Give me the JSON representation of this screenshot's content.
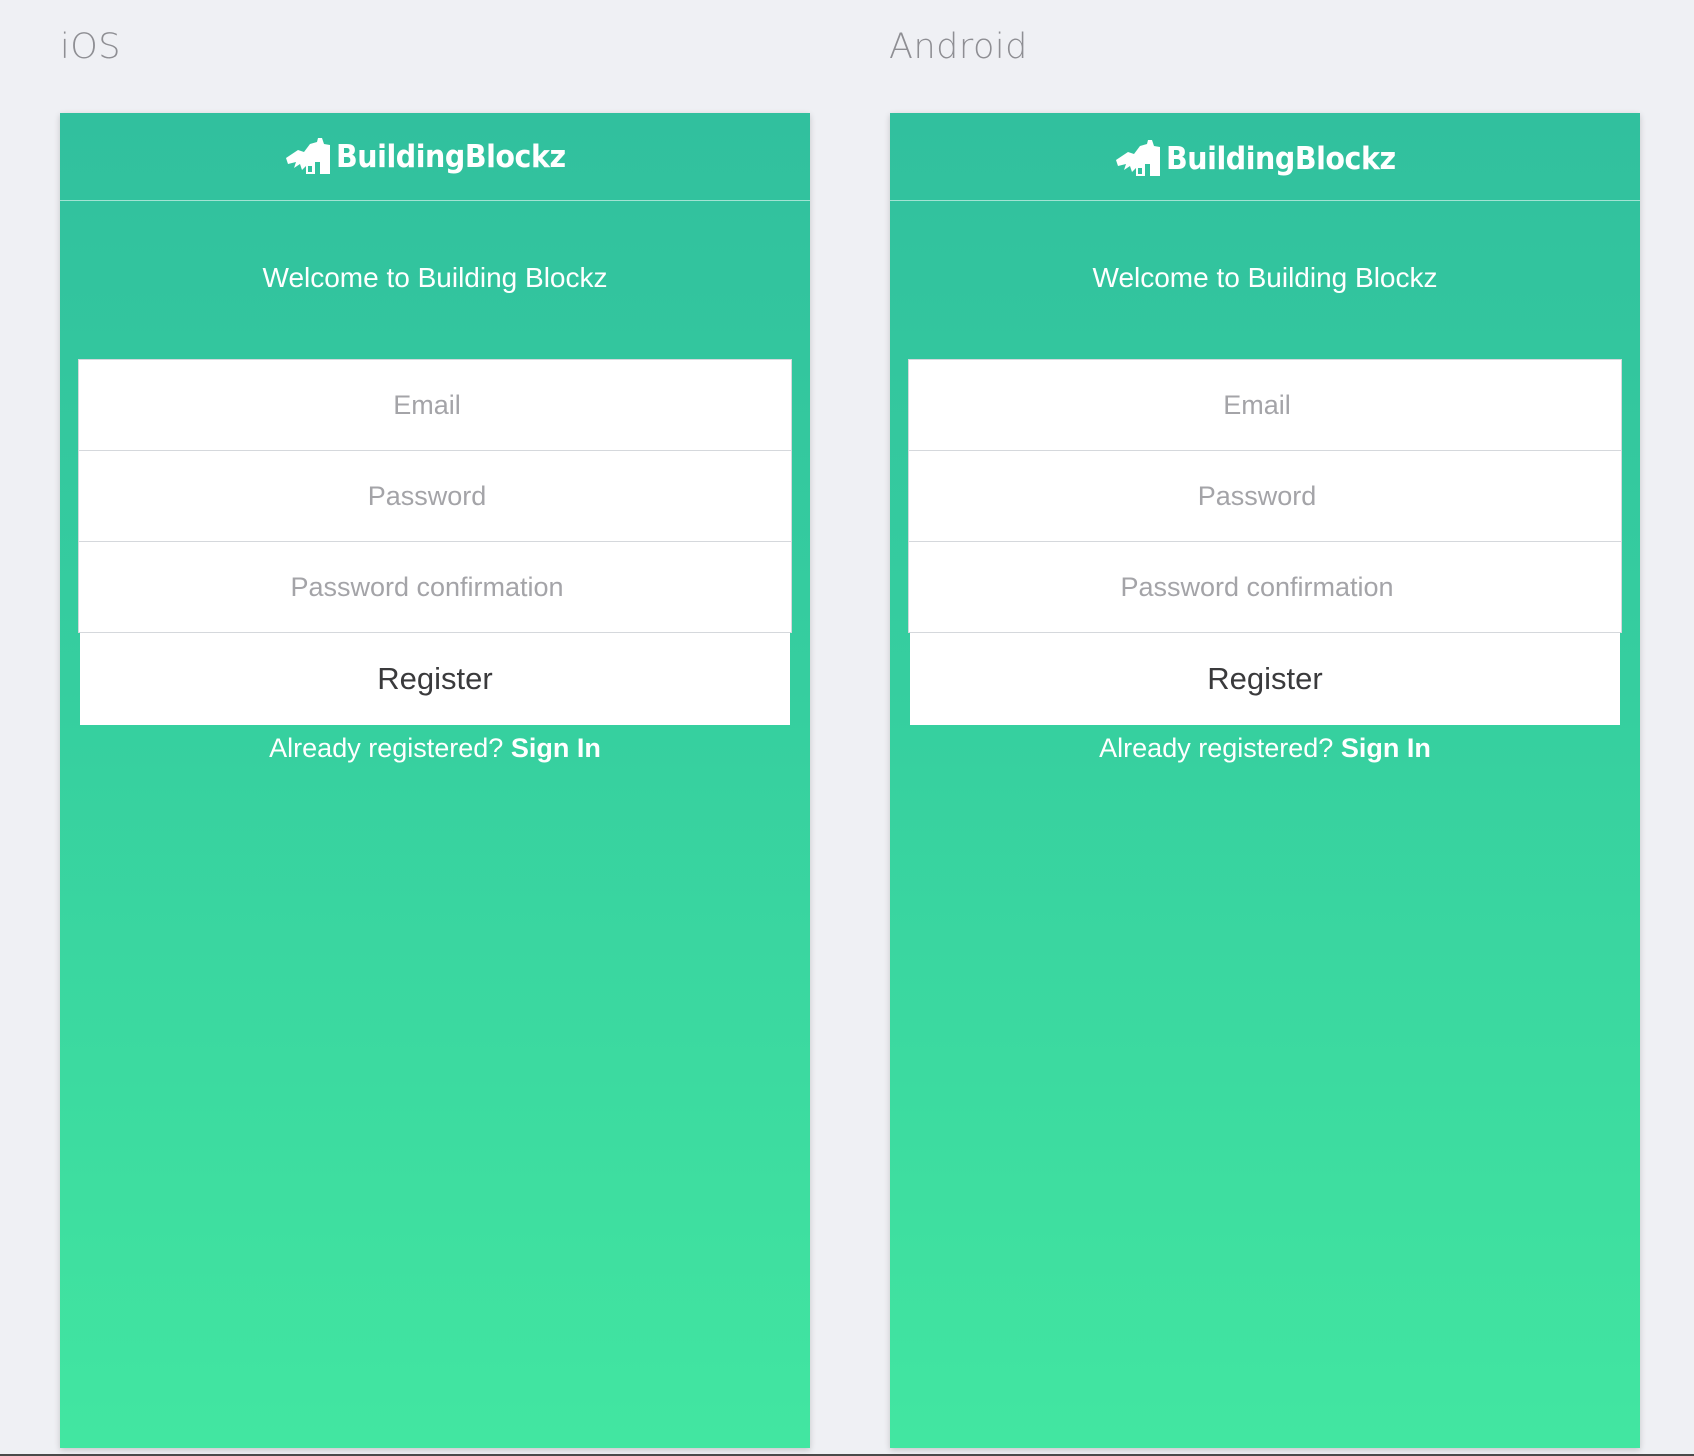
{
  "platforms": [
    {
      "label": "iOS",
      "logo_text": "BuildingBlockz",
      "welcome": "Welcome to Building Blockz",
      "email_placeholder": "Email",
      "password_placeholder": "Password",
      "password_confirmation_placeholder": "Password confirmation",
      "register_label": "Register",
      "already_registered": "Already registered?",
      "sign_in_label": "Sign In"
    },
    {
      "label": "Android",
      "logo_text": "BuildingBlockz",
      "welcome": "Welcome to Building Blockz",
      "email_placeholder": "Email",
      "password_placeholder": "Password",
      "password_confirmation_placeholder": "Password confirmation",
      "register_label": "Register",
      "already_registered": "Already registered?",
      "sign_in_label": "Sign In"
    }
  ],
  "colors": {
    "background": "#eff0f4",
    "gradient_top": "#31c09e",
    "gradient_bottom": "#42e6a1",
    "label": "#8e8e93"
  },
  "icons": {
    "logo": "building-blockz-logo-icon"
  }
}
